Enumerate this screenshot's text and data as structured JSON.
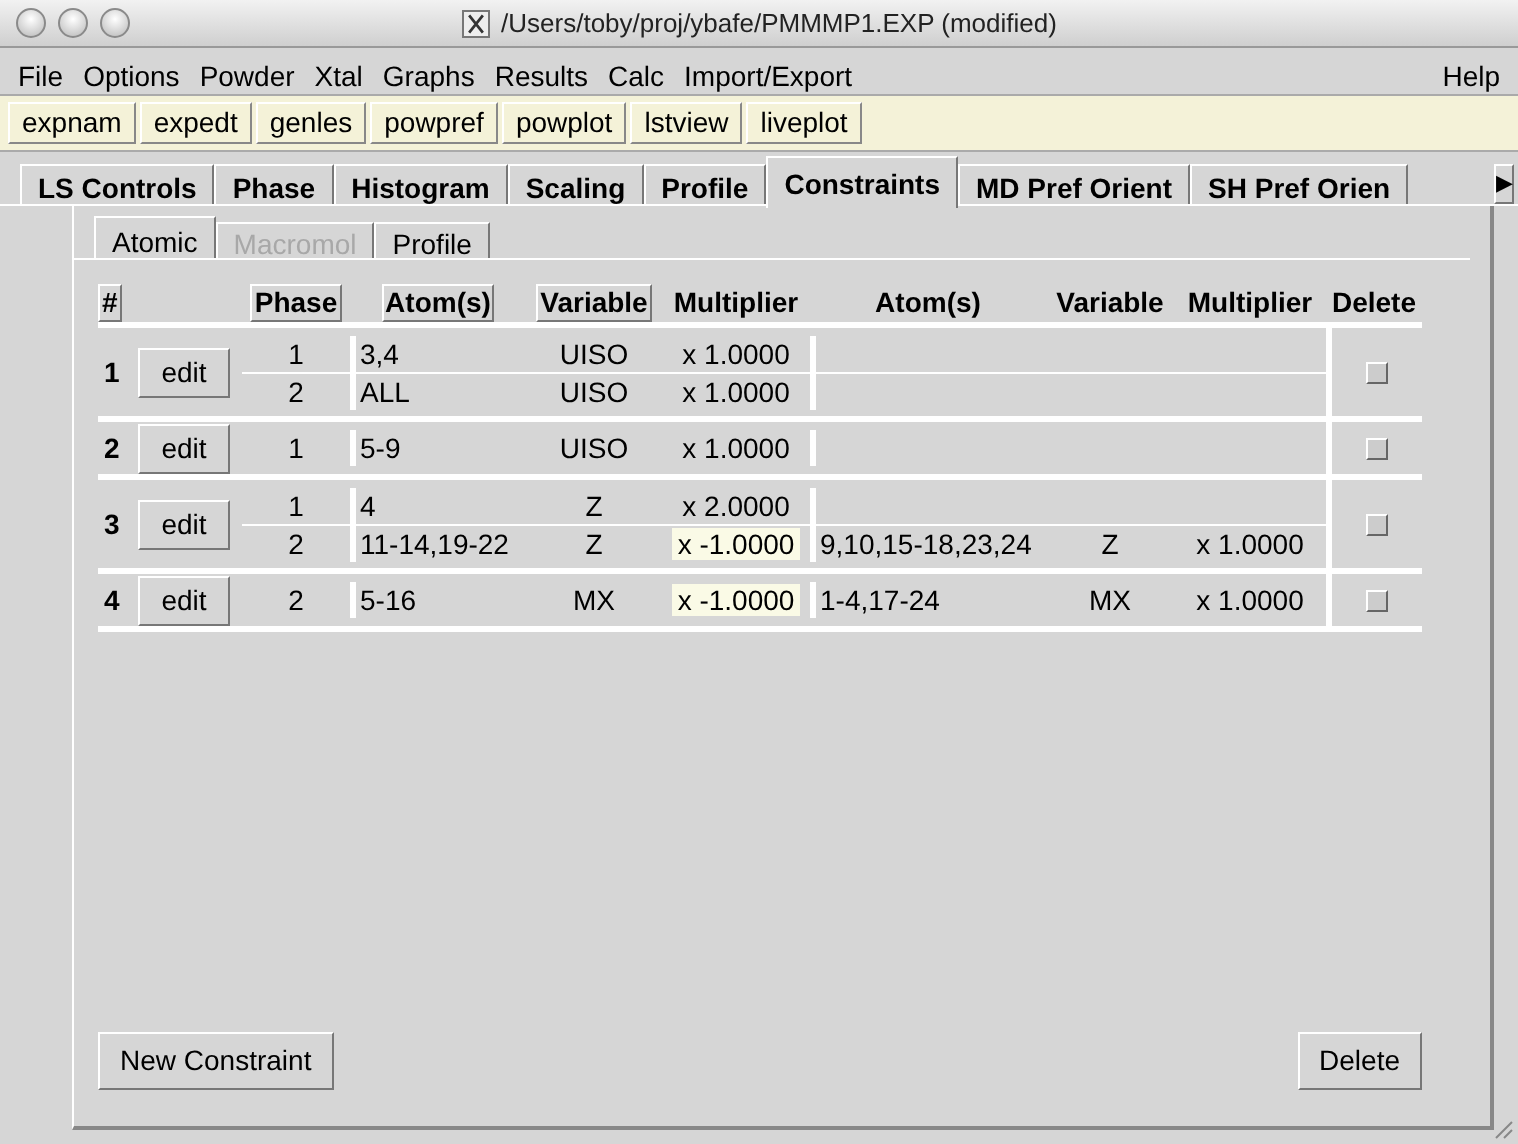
{
  "window": {
    "title": "/Users/toby/proj/ybafe/PMMMP1.EXP (modified)"
  },
  "menu": {
    "left": [
      "File",
      "Options",
      "Powder",
      "Xtal",
      "Graphs",
      "Results",
      "Calc",
      "Import/Export"
    ],
    "right": [
      "Help"
    ]
  },
  "toolbar": [
    "expnam",
    "expedt",
    "genles",
    "powpref",
    "powplot",
    "lstview",
    "liveplot"
  ],
  "tabs": [
    {
      "label": "LS Controls",
      "selected": false
    },
    {
      "label": "Phase",
      "selected": false
    },
    {
      "label": "Histogram",
      "selected": false
    },
    {
      "label": "Scaling",
      "selected": false
    },
    {
      "label": "Profile",
      "selected": false
    },
    {
      "label": "Constraints",
      "selected": true
    },
    {
      "label": "MD Pref Orient",
      "selected": false
    },
    {
      "label": "SH Pref Orien",
      "selected": false
    }
  ],
  "tab_scroll": "▶",
  "subtabs": [
    {
      "label": "Atomic",
      "selected": true,
      "disabled": false
    },
    {
      "label": "Macromol",
      "selected": false,
      "disabled": true
    },
    {
      "label": "Profile",
      "selected": false,
      "disabled": false
    }
  ],
  "columns": [
    {
      "label": "#",
      "kind": "button"
    },
    {
      "label": "Phase",
      "kind": "button"
    },
    {
      "label": "Atom(s)",
      "kind": "button"
    },
    {
      "label": "Variable",
      "kind": "button"
    },
    {
      "label": "Multiplier",
      "kind": "label"
    },
    {
      "label": "Atom(s)",
      "kind": "label"
    },
    {
      "label": "Variable",
      "kind": "label"
    },
    {
      "label": "Multiplier",
      "kind": "label"
    },
    {
      "label": "Delete",
      "kind": "label"
    }
  ],
  "constraints": [
    {
      "number": "1",
      "edit": "edit",
      "delete": false,
      "lines": [
        {
          "phase": "1",
          "atoms": "3,4",
          "variable": "UISO",
          "multiplier": "x 1.0000",
          "highlighted": false
        },
        {
          "phase": "2",
          "atoms": "ALL",
          "variable": "UISO",
          "multiplier": "x 1.0000",
          "highlighted": false
        }
      ]
    },
    {
      "number": "2",
      "edit": "edit",
      "delete": false,
      "lines": [
        {
          "phase": "1",
          "atoms": "5-9",
          "variable": "UISO",
          "multiplier": "x 1.0000",
          "highlighted": false
        }
      ]
    },
    {
      "number": "3",
      "edit": "edit",
      "delete": false,
      "lines": [
        {
          "phase": "1",
          "atoms": "4",
          "variable": "Z",
          "multiplier": "x 2.0000",
          "highlighted": false
        },
        {
          "phase": "2",
          "atoms": "11-14,19-22",
          "variable": "Z",
          "multiplier": "x -1.0000",
          "highlighted": true,
          "extra": {
            "atoms": "9,10,15-18,23,24",
            "variable": "Z",
            "multiplier": "x 1.0000"
          }
        }
      ]
    },
    {
      "number": "4",
      "edit": "edit",
      "delete": false,
      "lines": [
        {
          "phase": "2",
          "atoms": "5-16",
          "variable": "MX",
          "multiplier": "x -1.0000",
          "highlighted": true,
          "extra": {
            "atoms": "1-4,17-24",
            "variable": "MX",
            "multiplier": "x 1.0000"
          }
        }
      ]
    }
  ],
  "buttons": {
    "left": "New Constraint",
    "right": "Delete"
  }
}
